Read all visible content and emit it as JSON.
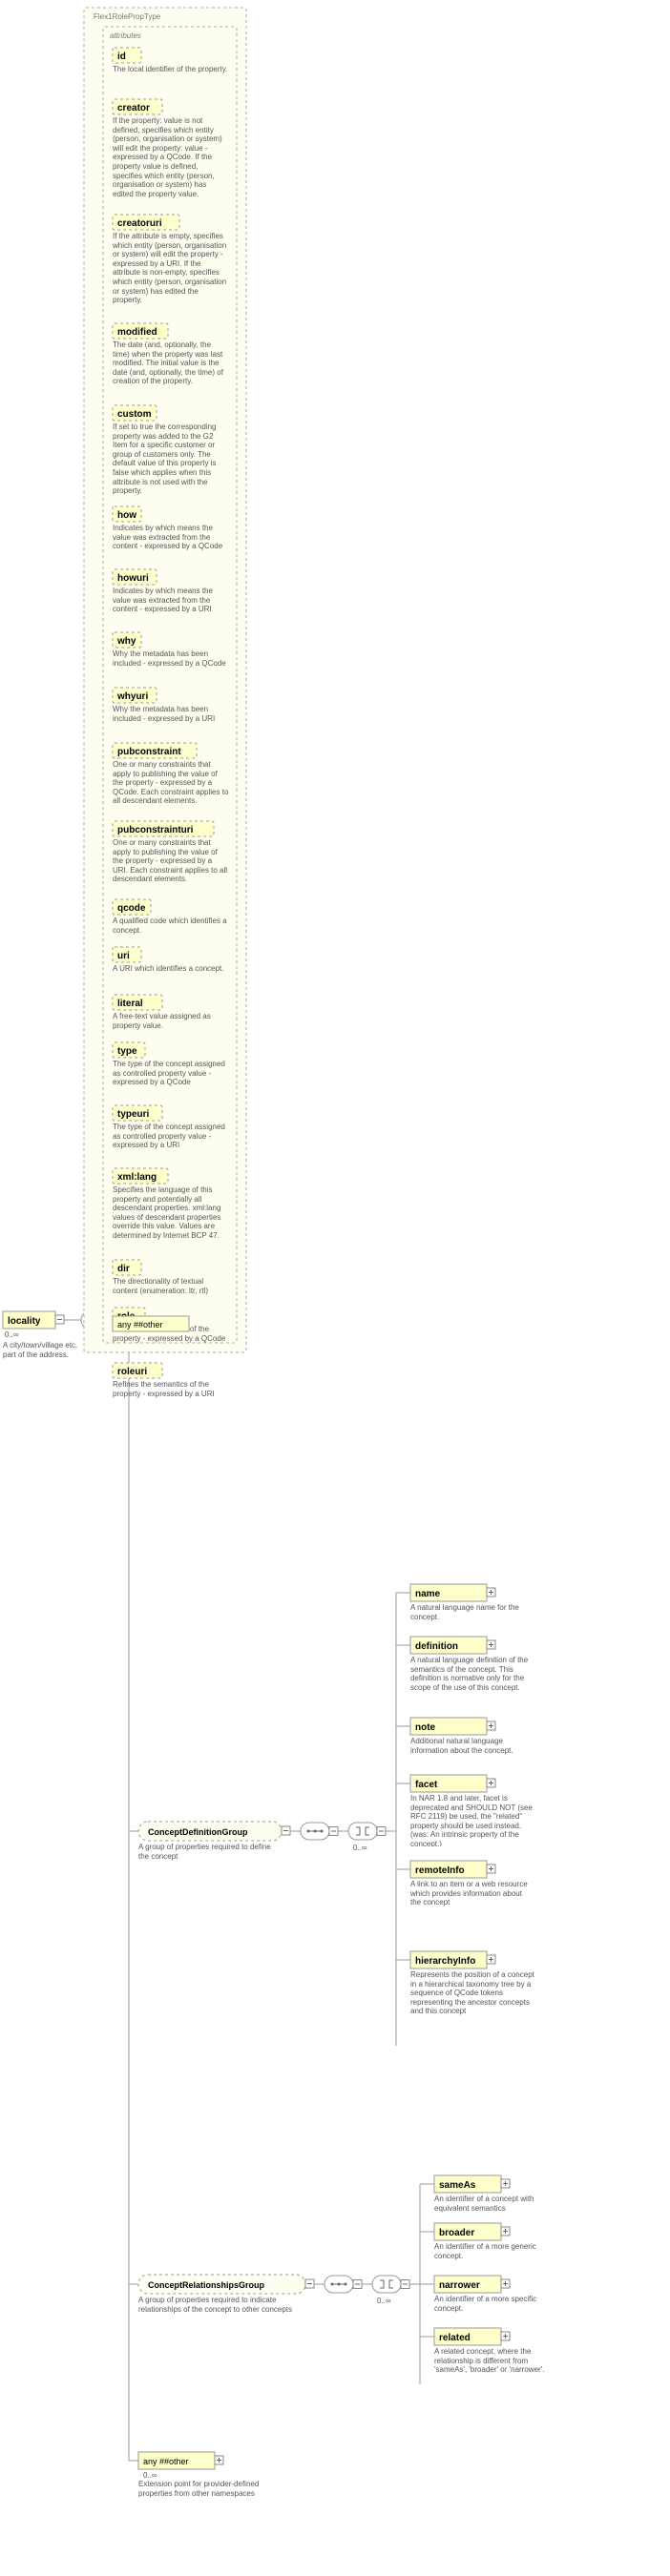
{
  "root": {
    "name": "locality",
    "occ": "0..∞",
    "desc": "A city/town/village etc. part of the address."
  },
  "typeLabel": "Flex1RolePropType",
  "attributesLabel": "attributes",
  "attrs": [
    {
      "name": "id",
      "desc": "The local identifier of the property."
    },
    {
      "name": "creator",
      "desc": "If the property: value is not defined, specifies which entity (person, organisation or system) will edit the property: value - expressed by a QCode. If the property value is defined, specifies which entity (person, organisation or system) has edited the property value.",
      "h": 95
    },
    {
      "name": "creatoruri",
      "desc": "If the attribute is empty, specifies which entity (person, organisation or system) will edit the property - expressed by a URI. If the attribute is non-empty, specifies which entity (person, organisation or system) has edited the property.",
      "h": 88
    },
    {
      "name": "modified",
      "desc": "The date (and, optionally, the time) when the property was last modified. The initial value is the date (and, optionally, the time) of creation of the property.",
      "h": 60
    },
    {
      "name": "custom",
      "desc": "If set to true the corresponding property was added to the G2 Item for a specific customer or group of customers only. The default value of this property is false which applies when this attribute is not used with the property.",
      "h": 80
    },
    {
      "name": "how",
      "desc": "Indicates by which means the value was extracted from the content - expressed by a QCode",
      "h": 40
    },
    {
      "name": "howuri",
      "desc": "Indicates by which means the value was extracted from the content - expressed by a URI",
      "h": 40
    },
    {
      "name": "why",
      "desc": "Why the metadata has been included - expressed by a QCode",
      "h": 32
    },
    {
      "name": "whyuri",
      "desc": "Why the metadata has been included - expressed by a URI",
      "h": 32
    },
    {
      "name": "pubconstraint",
      "desc": "One or many constraints that apply to publishing the value of the property - expressed by a QCode. Each constraint applies to all descendant elements.",
      "h": 56
    },
    {
      "name": "pubconstrainturi",
      "desc": "One or many constraints that apply to publishing the value of the property - expressed by a URI. Each constraint applies to all descendant elements.",
      "h": 56
    },
    {
      "name": "qcode",
      "desc": "A qualified code which identifies a concept.",
      "h": 24
    },
    {
      "name": "uri",
      "desc": "A URI which identifies a concept.",
      "h": 24
    },
    {
      "name": "literal",
      "desc": "A free-text value assigned as property value.",
      "h": 24
    },
    {
      "name": "type",
      "desc": "The type of the concept assigned as controlled property value - expressed by a QCode",
      "h": 40
    },
    {
      "name": "typeuri",
      "desc": "The type of the concept assigned as controlled property value - expressed by a URI",
      "h": 40
    },
    {
      "name": "xml:lang",
      "desc": "Specifies the language of this property and potentially all descendant properties. xml:lang values of descendant properties override this value. Values are determined by Internet BCP 47.",
      "h": 70
    },
    {
      "name": "dir",
      "desc": "The directionality of textual content (enumeration: ltr, rtl)",
      "h": 24
    },
    {
      "name": "role",
      "desc": "Refines the semantics of the property - expressed by a QCode",
      "h": 32
    },
    {
      "name": "roleuri",
      "desc": "Refines the semantics of the property - expressed by a URI",
      "h": 32
    }
  ],
  "anyOther": "any ##other",
  "groups": {
    "def": {
      "name": "ConceptDefinitionGroup",
      "desc": "A group of properties required to define the concept",
      "occ": "0..∞",
      "children": [
        {
          "name": "name",
          "desc": "A natural language name for the concept."
        },
        {
          "name": "definition",
          "desc": "A natural language definition of the semantics of the concept. This definition is normative only for the scope of the use of this concept.",
          "h": 50
        },
        {
          "name": "note",
          "desc": "Additional natural language information about the concept.",
          "h": 30
        },
        {
          "name": "facet",
          "desc": "In NAR 1.8 and later, facet is deprecated and SHOULD NOT (see RFC 2119) be used, the \"related\" property should be used instead. (was: An intrinsic property of the concept.)",
          "h": 55
        },
        {
          "name": "remoteInfo",
          "desc": "A link to an item or a web resource which provides information about the concept",
          "h": 38
        },
        {
          "name": "hierarchyInfo",
          "desc": "Represents the position of a concept in a hierarchical taxonomy tree by a sequence of QCode tokens representing the ancestor concepts and this concept",
          "h": 55
        }
      ]
    },
    "rel": {
      "name": "ConceptRelationshipsGroup",
      "desc": "A group of properties required to indicate relationships of the concept to other concepts",
      "occ": "0..∞",
      "children": [
        {
          "name": "sameAs",
          "desc": "An identifier of a concept with equivalent semantics"
        },
        {
          "name": "broader",
          "desc": "An identifier of a more generic concept."
        },
        {
          "name": "narrower",
          "desc": "An identifier of a more specific concept."
        },
        {
          "name": "related",
          "desc": "A related concept, where the relationship is different from 'sameAs', 'broader' or 'narrower'.",
          "h": 40
        }
      ]
    },
    "ext": {
      "name": "any ##other",
      "occ": "0..∞",
      "desc": "Extension point for provider-defined properties from other namespaces"
    }
  }
}
